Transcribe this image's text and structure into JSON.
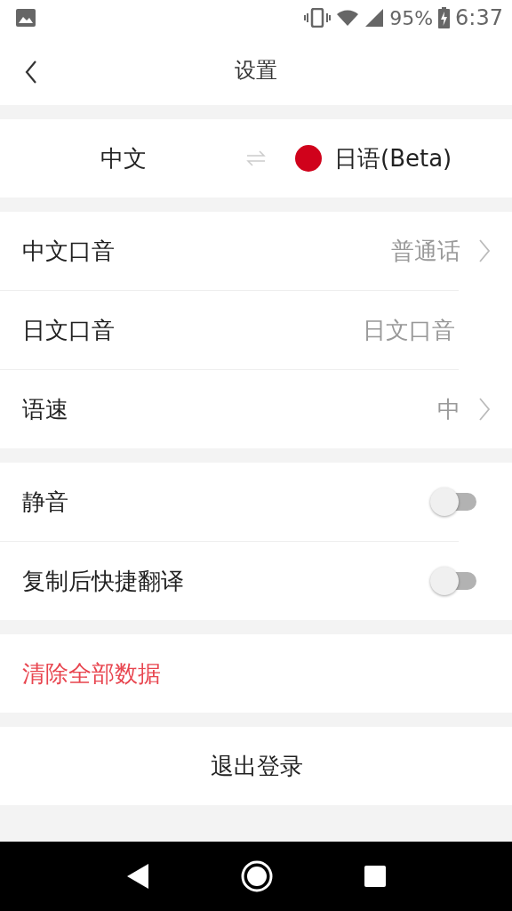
{
  "status_bar": {
    "battery": "95%",
    "time": "6:37"
  },
  "header": {
    "title": "设置"
  },
  "languages": {
    "from": "中文",
    "to": {
      "label": "日语(Beta)",
      "color": "#d0021b"
    }
  },
  "groups": [
    {
      "rows": [
        {
          "kind": "chevron",
          "label": "中文口音",
          "value": "普通话"
        },
        {
          "kind": "value",
          "label": "日文口音",
          "value": "日文口音"
        },
        {
          "kind": "chevron",
          "label": "语速",
          "value": "中"
        }
      ]
    },
    {
      "rows": [
        {
          "kind": "toggle",
          "label": "静音",
          "on": false
        },
        {
          "kind": "toggle",
          "label": "复制后快捷翻译",
          "on": false
        }
      ]
    },
    {
      "rows": [
        {
          "kind": "danger",
          "label": "清除全部数据"
        }
      ]
    },
    {
      "rows": [
        {
          "kind": "center",
          "label": "退出登录"
        }
      ]
    }
  ]
}
